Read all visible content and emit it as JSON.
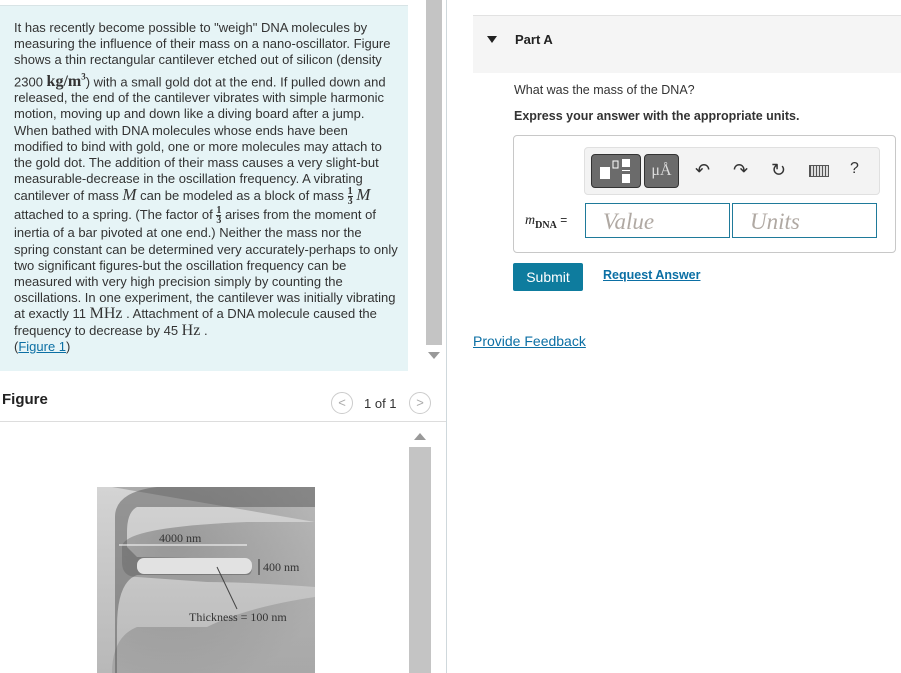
{
  "problem": {
    "p1": "It has recently become possible to \"weigh\" DNA molecules by measuring the influence of their mass on a nano-oscillator. Figure shows a thin rectangular cantilever etched out of silicon (density 2300 ",
    "density_unit": "kg/m",
    "density_exp": "3",
    "p2": ") with a small gold dot at the end. If pulled down and released, the end of the cantilever vibrates with simple harmonic motion, moving up and down like a diving board after a jump. When bathed with DNA molecules whose ends have been modified to bind with gold, one or more molecules may attach to the gold dot. The addition of their mass causes a very slight-but measurable-decrease in the oscillation frequency. A vibrating cantilever of mass ",
    "mass_symbol": "M",
    "p3": " can be modeled as a block of mass ",
    "frac_num": "1",
    "frac_den": "3",
    "p4": " attached to a spring. (The factor of ",
    "p5": " arises from the moment of inertia of a bar pivoted at one end.) Neither the mass nor the spring constant can be determined very accurately-perhaps to only two significant figures-but the oscillation frequency can be measured with very high precision simply by counting the oscillations. In one experiment, the cantilever was initially vibrating at exactly 11 ",
    "unit_mhz": "MHz",
    "p6": " . Attachment of a DNA molecule caused the frequency to decrease by 45 ",
    "unit_hz": "Hz",
    "p7": " .",
    "figure_link_open": "(",
    "figure_link": "Figure 1",
    "figure_link_close": ")"
  },
  "figure": {
    "title": "Figure",
    "pager": "1 of 1",
    "labels": {
      "length": "4000 nm",
      "height": "400 nm",
      "thickness": "Thickness = 100 nm"
    }
  },
  "part": {
    "title": "Part A",
    "question": "What was the mass of the DNA?",
    "instruction": "Express your answer with the appropriate units.",
    "var_main": "m",
    "var_sub": "DNA",
    "equals": "=",
    "value_placeholder": "Value",
    "units_placeholder": "Units",
    "units_button": "μÅ",
    "help": "?",
    "submit": "Submit",
    "request_answer": "Request Answer",
    "feedback": "Provide Feedback"
  },
  "colors": {
    "accent": "#0e7c9e",
    "problem_bg": "#e6f4f6",
    "link": "#0b6fa4"
  }
}
